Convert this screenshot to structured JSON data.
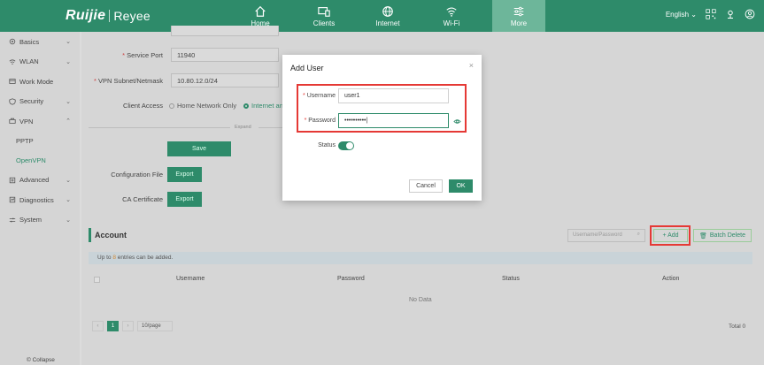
{
  "brand": {
    "logo_left": "Ruijie",
    "logo_right": "Reyee"
  },
  "colors": {
    "brand": "#2e8b6a",
    "highlight": "#e53935",
    "active_nav": "#6db69a"
  },
  "topnav": {
    "items": [
      {
        "label": "Home",
        "icon": "home-icon"
      },
      {
        "label": "Clients",
        "icon": "devices-icon"
      },
      {
        "label": "Internet",
        "icon": "globe-icon"
      },
      {
        "label": "Wi-Fi",
        "icon": "wifi-icon"
      },
      {
        "label": "More",
        "icon": "sliders-icon",
        "active": true
      }
    ],
    "language": "English"
  },
  "sidebar": {
    "items": [
      {
        "label": "Basics"
      },
      {
        "label": "WLAN"
      },
      {
        "label": "Work Mode"
      },
      {
        "label": "Security"
      },
      {
        "label": "VPN"
      },
      {
        "label": "PPTP"
      },
      {
        "label": "OpenVPN"
      },
      {
        "label": "Advanced"
      },
      {
        "label": "Diagnostics"
      },
      {
        "label": "System"
      }
    ],
    "collapse": "© Collapse"
  },
  "form": {
    "service_port_label": "Service Port",
    "service_port_value": "11940",
    "vpn_subnet_label": "VPN Subnet/Netmask",
    "vpn_subnet_value": "10.80.12.0/24",
    "client_access_label": "Client Access",
    "client_access_opt1": "Home Network Only",
    "client_access_opt2": "Internet an",
    "expand": "Expand",
    "save": "Save",
    "config_file_label": "Configuration File",
    "ca_cert_label": "CA Certificate",
    "export": "Export"
  },
  "account": {
    "title": "Account",
    "search_placeholder": "Username/Password",
    "add": "+ Add",
    "batch_delete": "Batch Delete",
    "notice_prefix": "Up to",
    "notice_count": "8",
    "notice_suffix": "entries can be added.",
    "columns": [
      "Username",
      "Password",
      "Status",
      "Action"
    ],
    "no_data": "No Data",
    "page": "1",
    "page_size": "10/page",
    "total": "Total 0"
  },
  "modal": {
    "title": "Add User",
    "close": "×",
    "username_label": "Username",
    "username_value": "user1",
    "password_label": "Password",
    "password_value": "••••••••••|",
    "status_label": "Status",
    "status_on": true,
    "cancel": "Cancel",
    "ok": "OK"
  }
}
